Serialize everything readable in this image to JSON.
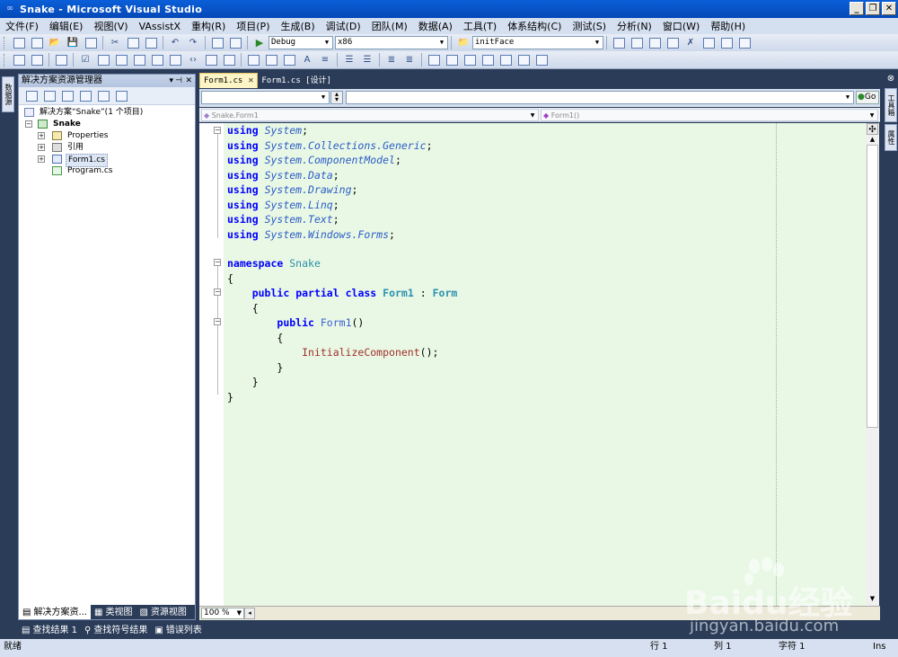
{
  "window": {
    "title": "Snake - Microsoft Visual Studio"
  },
  "menu": [
    "文件(F)",
    "编辑(E)",
    "视图(V)",
    "VAssistX",
    "重构(R)",
    "项目(P)",
    "生成(B)",
    "调试(D)",
    "团队(M)",
    "数据(A)",
    "工具(T)",
    "体系结构(C)",
    "测试(S)",
    "分析(N)",
    "窗口(W)",
    "帮助(H)"
  ],
  "toolbar": {
    "config": "Debug",
    "platform": "x86",
    "find_text": "initFace"
  },
  "left_strip": {
    "tab": "数据源"
  },
  "solution_explorer": {
    "title": "解决方案资源管理器",
    "tree": {
      "solution": "解决方案“Snake”(1 个项目)",
      "project": "Snake",
      "items": [
        "Properties",
        "引用",
        "Form1.cs",
        "Program.cs"
      ]
    },
    "tabs": [
      "解决方案资...",
      "类视图",
      "资源视图"
    ]
  },
  "editor": {
    "tabs": [
      "Form1.cs",
      "Form1.cs [设计]"
    ],
    "go_button": "Go",
    "class_nav": "Snake.Form1",
    "member_nav": "Form1()",
    "zoom": "100 %"
  },
  "code": {
    "usings": [
      "System",
      "System.Collections.Generic",
      "System.ComponentModel",
      "System.Data",
      "System.Drawing",
      "System.Linq",
      "System.Text",
      "System.Windows.Forms"
    ],
    "kw_using": "using",
    "kw_namespace": "namespace",
    "namespace_name": "Snake",
    "kw_public": "public",
    "kw_partial": "partial",
    "kw_class": "class",
    "class_name": "Form1",
    "base_class": "Form",
    "ctor_name": "Form1",
    "call": "InitializeComponent"
  },
  "right_strip": {
    "tabs": [
      "工具箱",
      "属性"
    ]
  },
  "bottom_tabs": [
    "查找结果 1",
    "查找符号结果",
    "错误列表"
  ],
  "status": {
    "left": "就绪",
    "row": "行 1",
    "col": "列 1",
    "char": "字符 1",
    "mode": "Ins"
  },
  "watermark": {
    "brand": "Baidu经验",
    "url": "jingyan.baidu.com"
  }
}
